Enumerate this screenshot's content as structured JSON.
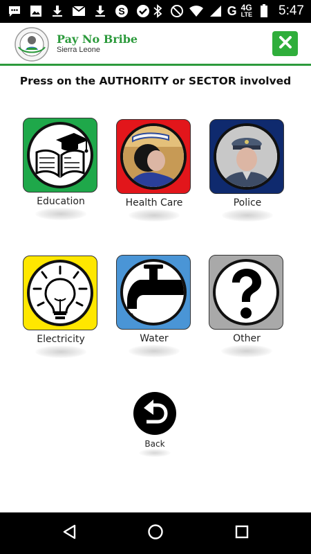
{
  "status_bar": {
    "left_icons": [
      "chat-bubble-icon",
      "image-icon",
      "download-icon",
      "gmail-icon",
      "download-icon",
      "skype-icon",
      "check-circle-icon"
    ],
    "right_icons": [
      "bluetooth-icon",
      "do-not-disturb-icon",
      "wifi-icon",
      "signal-icon",
      "battery-icon"
    ],
    "network": "G",
    "network_4g": "4G",
    "network_lte": "LTE",
    "time": "5:47"
  },
  "header": {
    "title": "Pay No Bribe",
    "subtitle": "Sierra Leone",
    "close_icon": "close-icon",
    "accent": "#2c9a3c"
  },
  "instruction": "Press on the AUTHORITY or SECTOR involved",
  "sectors": [
    {
      "label": "Education",
      "icon": "education-book-cap-icon",
      "color": "#1fa84a"
    },
    {
      "label": "Health Care",
      "icon": "health-care-nurse-photo",
      "color": "#e2161b"
    },
    {
      "label": "Police",
      "icon": "police-officer-photo",
      "color": "#0f2a6e"
    },
    {
      "label": "Electricity",
      "icon": "light-bulb-icon",
      "color": "#ffe700"
    },
    {
      "label": "Water",
      "icon": "water-tap-icon",
      "color": "#4a95d6"
    },
    {
      "label": "Other",
      "icon": "question-mark-icon",
      "color": "#a9a9a9"
    }
  ],
  "back": {
    "label": "Back",
    "icon": "back-arrow-icon"
  },
  "navbar": {
    "icons": [
      "back-triangle-icon",
      "home-circle-icon",
      "recents-square-icon"
    ]
  }
}
